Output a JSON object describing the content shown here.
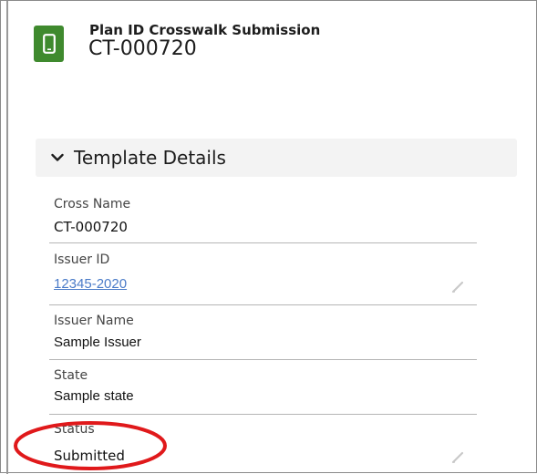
{
  "record": {
    "type_label": "Plan ID Crosswalk Submission",
    "title": "CT-000720",
    "icon": "mobile-device-icon",
    "icon_color": "#3f8a2e"
  },
  "section": {
    "title": "Template Details",
    "icon": "chevron-down-icon"
  },
  "fields": {
    "cross_name": {
      "label": "Cross Name",
      "value": "CT-000720"
    },
    "issuer_id": {
      "label": "Issuer ID",
      "value": "12345-2020"
    },
    "issuer_name": {
      "label": "Issuer Name",
      "value": "Sample Issuer"
    },
    "state": {
      "label": "State",
      "value": "Sample state"
    },
    "status": {
      "label": "Status",
      "value": "Submitted"
    }
  },
  "colors": {
    "link": "#4a7bc8",
    "highlight": "#e0191b",
    "section_bg": "#f3f3f3"
  }
}
